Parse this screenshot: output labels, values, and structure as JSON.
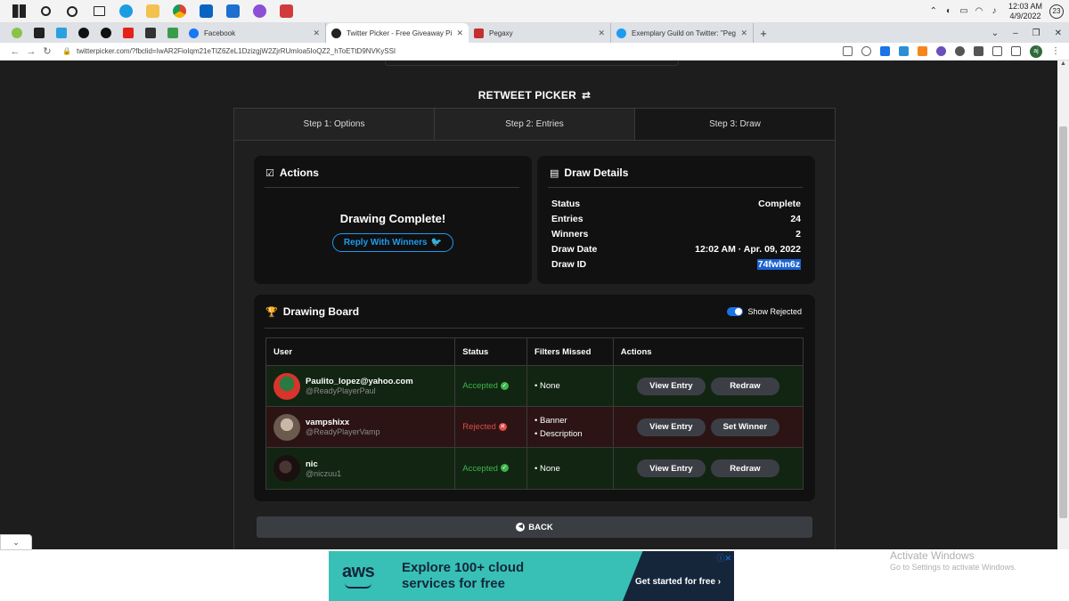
{
  "taskbar": {
    "clock_time": "12:03 AM",
    "clock_date": "4/9/2022",
    "notifications": "23"
  },
  "browser": {
    "tabs": [
      {
        "title": "Facebook",
        "favicon_color": "#1877f2",
        "active": false
      },
      {
        "title": "Twitter Picker - Free Giveaway Pi",
        "favicon_color": "#222222",
        "active": true
      },
      {
        "title": "Pegaxy",
        "favicon_color": "#c4302b",
        "active": false
      },
      {
        "title": "Exemplary Guild on Twitter: \"Peg",
        "favicon_color": "#1d9bf0",
        "active": false
      }
    ],
    "new_tab_label": "+",
    "url": "twitterpicker.com/?fbclid=IwAR2FioIqm21eTIZ6ZeL1DzizgjW2ZjrRUmIoa5IoQZ2_hToETtD9NVKySSI",
    "profile_initials": "aj"
  },
  "picker": {
    "title": "RETWEET PICKER",
    "steps": [
      "Step 1: Options",
      "Step 2: Entries",
      "Step 3: Draw"
    ]
  },
  "actions": {
    "heading": "Actions",
    "status_message": "Drawing Complete!",
    "reply_button": "Reply With Winners"
  },
  "draw_details": {
    "heading": "Draw Details",
    "rows": [
      {
        "label": "Status",
        "value": "Complete"
      },
      {
        "label": "Entries",
        "value": "24"
      },
      {
        "label": "Winners",
        "value": "2"
      },
      {
        "label": "Draw Date",
        "value": "12:02 AM · Apr. 09, 2022"
      },
      {
        "label": "Draw ID",
        "value": "74fwhn6z"
      }
    ]
  },
  "board": {
    "heading": "Drawing Board",
    "toggle_label": "Show Rejected",
    "toggle_on": true,
    "columns": [
      "User",
      "Status",
      "Filters Missed",
      "Actions"
    ],
    "rows": [
      {
        "name": "Paulito_lopez@yahoo.com",
        "handle": "@ReadyPlayerPaul",
        "status": "Accepted",
        "filters": [
          "None"
        ],
        "btn1": "View Entry",
        "btn2": "Redraw",
        "avatar_color": "#d8342c"
      },
      {
        "name": "vampshixx",
        "handle": "@ReadyPlayerVamp",
        "status": "Rejected",
        "filters": [
          "Banner",
          "Description"
        ],
        "btn1": "View Entry",
        "btn2": "Set Winner",
        "avatar_color": "#6b5a4e"
      },
      {
        "name": "nic",
        "handle": "@niczuu1",
        "status": "Accepted",
        "filters": [
          "None"
        ],
        "btn1": "View Entry",
        "btn2": "Redraw",
        "avatar_color": "#2a1d1d"
      }
    ],
    "back_button": "BACK"
  },
  "ad": {
    "brand": "aws",
    "headline_1": "Explore 100+ cloud",
    "headline_2": "services for free",
    "cta": "Get started for free ›"
  },
  "watermark": {
    "line1": "Activate Windows",
    "line2": "Go to Settings to activate Windows."
  },
  "colors": {
    "accent_blue": "#1d9bf0",
    "accepted_green": "#3cb54a",
    "rejected_red": "#e04a4a"
  }
}
